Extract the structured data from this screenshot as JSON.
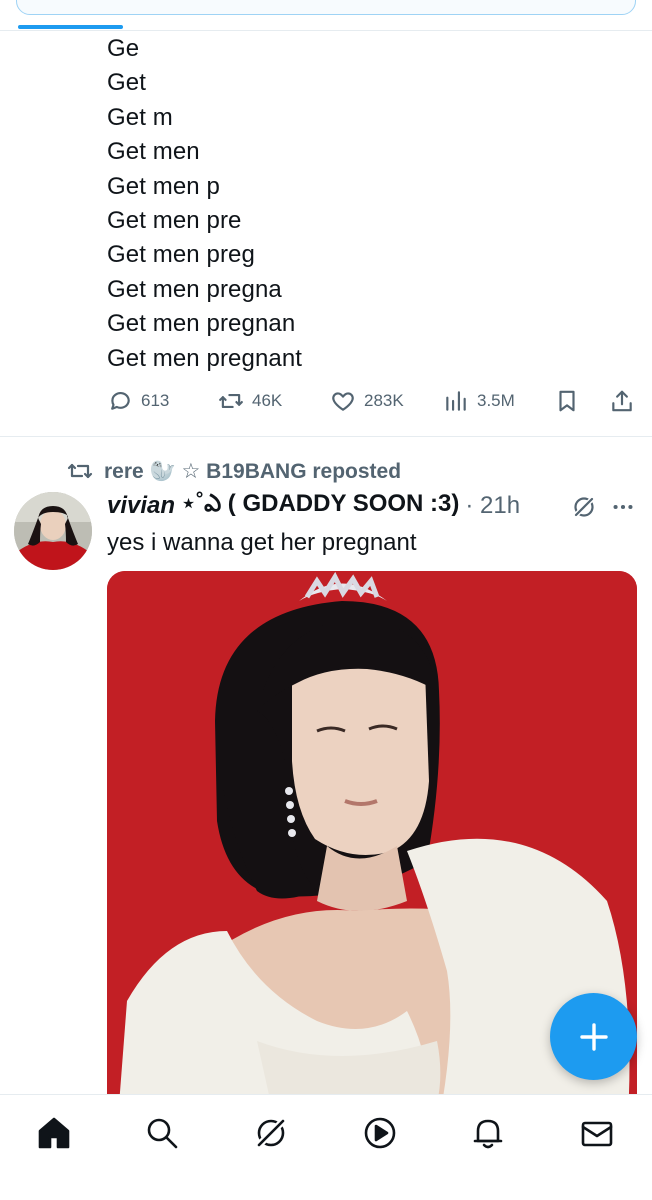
{
  "tweet1": {
    "lines": [
      "Ge",
      "Get",
      "Get m",
      "Get men",
      "Get men p",
      "Get men pre",
      "Get men preg",
      "Get men pregna",
      "Get men pregnan",
      "Get men pregnant"
    ],
    "actions": {
      "replies": "613",
      "reposts": "46K",
      "likes": "283K",
      "views": "3.5M"
    }
  },
  "tweet2": {
    "repost_label": "rere 🦭 ☆ B19BANG reposted",
    "author_name": "vivian",
    "author_suffix": "⋆˚ఎ ( GDADDY SOON :3)",
    "timestamp": "· 21h",
    "text": "yes i wanna get her pregnant"
  },
  "colors": {
    "accent": "#1d9bf0",
    "text": "#0f1419",
    "muted": "#536471",
    "photo_background": "#c21f25"
  },
  "icons": {
    "reply": "speech-bubble-icon",
    "repost": "repost-arrows-icon",
    "like": "heart-icon",
    "views": "bar-chart-icon",
    "bookmark": "bookmark-icon",
    "share": "share-icon",
    "grok": "grok-icon",
    "more": "more-dots-icon",
    "compose": "plus-icon",
    "nav": [
      "home-icon",
      "search-icon",
      "grok-icon",
      "video-icon",
      "bell-icon",
      "mail-icon"
    ]
  }
}
